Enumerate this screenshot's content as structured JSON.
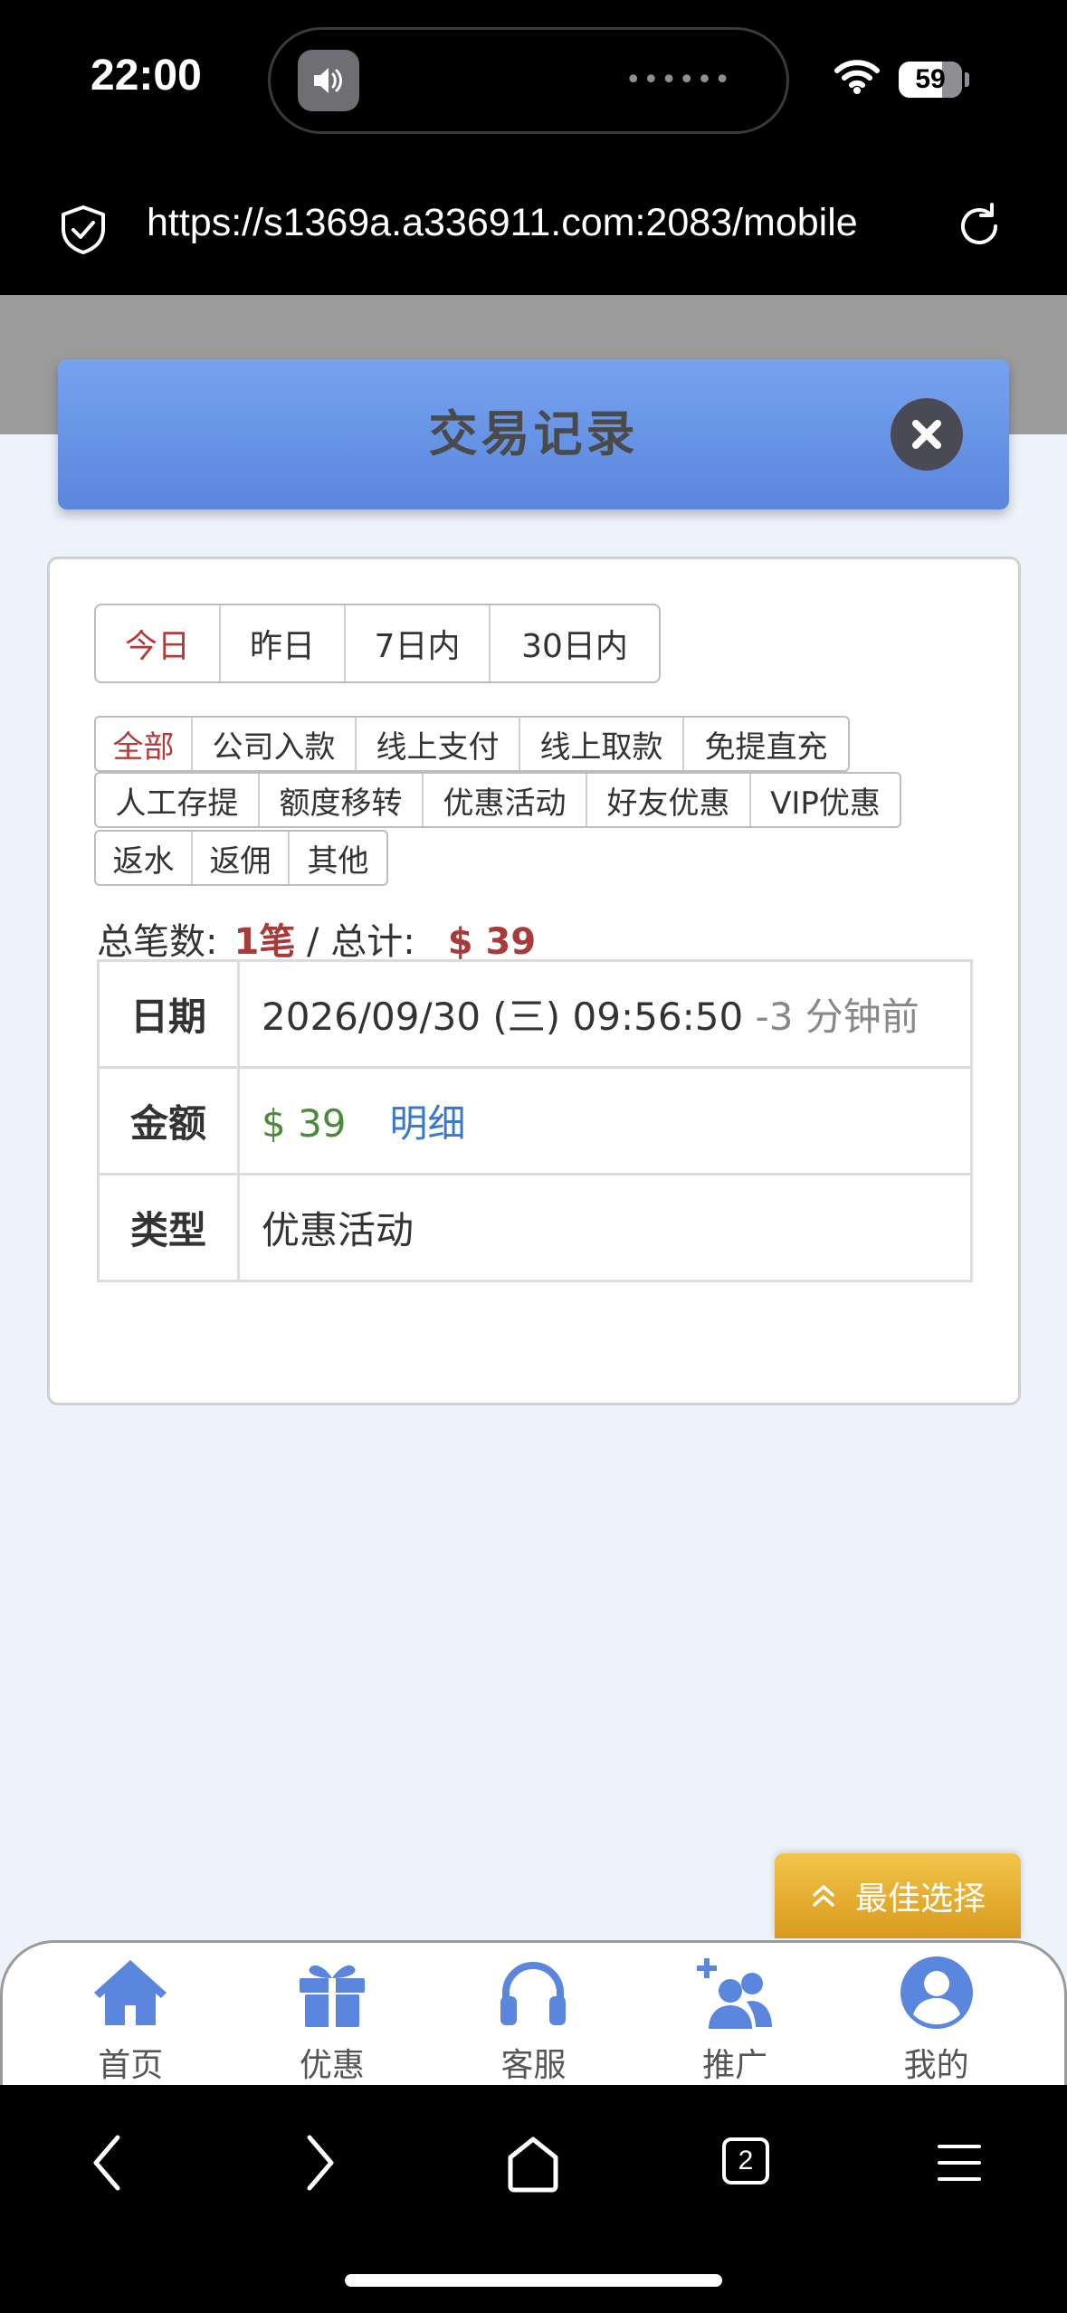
{
  "status_bar": {
    "time": "22:00",
    "battery": "59"
  },
  "browser": {
    "url": "https://s1369a.a336911.com:2083/mobile",
    "tabs_count": "2"
  },
  "modal": {
    "title": "交易记录"
  },
  "date_filters": [
    {
      "label": "今日",
      "active": true
    },
    {
      "label": "昨日",
      "active": false
    },
    {
      "label": "7日内",
      "active": false
    },
    {
      "label": "30日内",
      "active": false
    }
  ],
  "type_filters": [
    [
      {
        "label": "全部",
        "active": true
      },
      {
        "label": "公司入款"
      },
      {
        "label": "线上支付"
      },
      {
        "label": "线上取款"
      },
      {
        "label": "免提直充"
      }
    ],
    [
      {
        "label": "人工存提"
      },
      {
        "label": "额度移转"
      },
      {
        "label": "优惠活动"
      },
      {
        "label": "好友优惠"
      },
      {
        "label": "VIP优惠"
      }
    ],
    [
      {
        "label": "返水"
      },
      {
        "label": "返佣"
      },
      {
        "label": "其他"
      }
    ]
  ],
  "summary": {
    "count_label": "总笔数:",
    "count_value": "1笔",
    "separator": "/",
    "total_label": "总计:",
    "total_value": "$ 39"
  },
  "record": {
    "date_key": "日期",
    "date_value": "2026/09/30 (三) 09:56:50",
    "date_relative": "-3 分钟前",
    "amount_key": "金额",
    "amount_value": "$ 39",
    "detail_link": "明细",
    "type_key": "类型",
    "type_value": "优惠活动"
  },
  "best_choice": "最佳选择",
  "tabbar": [
    {
      "label": "首页",
      "icon": "home-icon"
    },
    {
      "label": "优惠",
      "icon": "gift-icon"
    },
    {
      "label": "客服",
      "icon": "headset-icon"
    },
    {
      "label": "推广",
      "icon": "add-users-icon"
    },
    {
      "label": "我的",
      "icon": "user-icon"
    }
  ],
  "colors": {
    "accent_blue": "#5b86dd",
    "active_red": "#b33a3a",
    "amount_green": "#4a8a3a",
    "link_blue": "#3a78c8",
    "gold": "#e0a92c"
  }
}
